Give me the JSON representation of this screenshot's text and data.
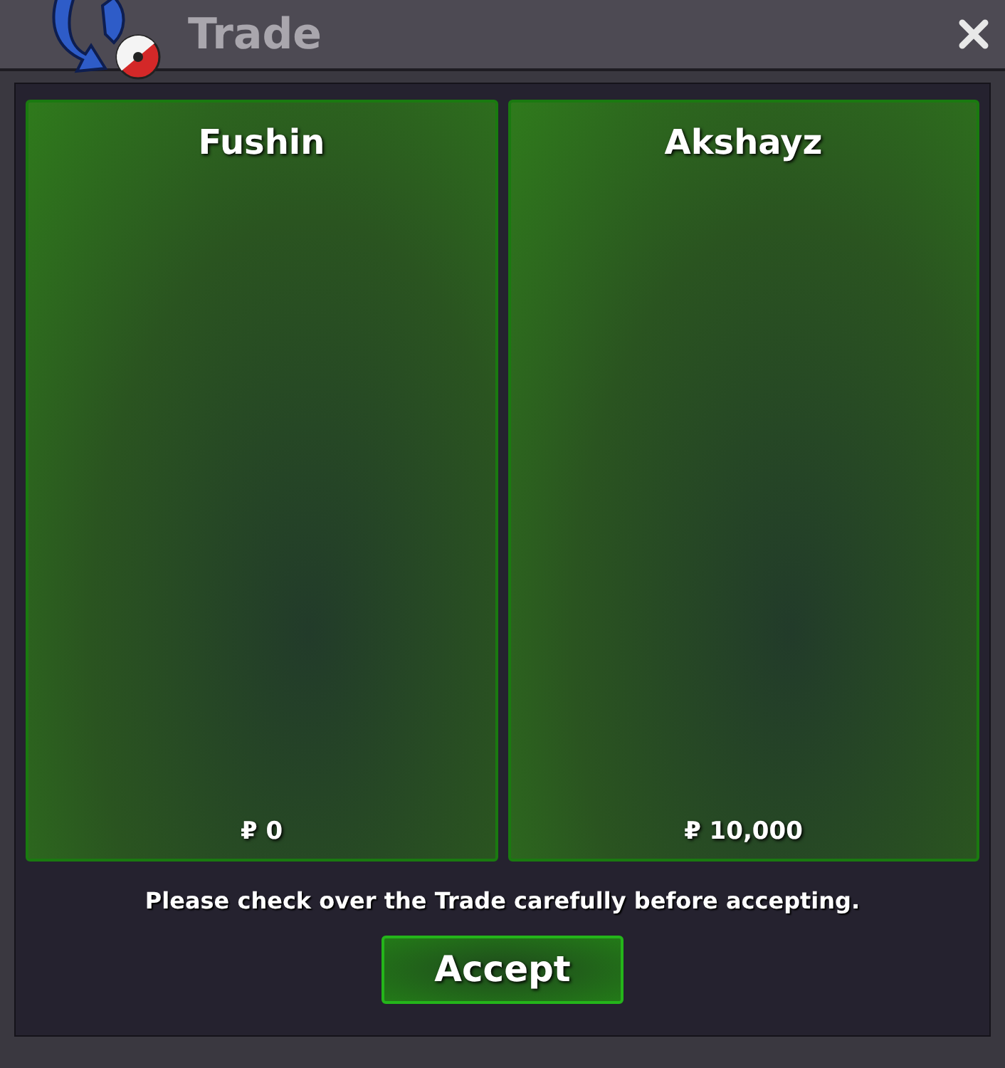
{
  "window": {
    "title": "Trade"
  },
  "offers": [
    {
      "name": "Fushin",
      "money": "₽ 0"
    },
    {
      "name": "Akshayz",
      "money": "₽ 10,000"
    }
  ],
  "message": "Please check over the Trade carefully before accepting.",
  "buttons": [
    "Accept"
  ]
}
